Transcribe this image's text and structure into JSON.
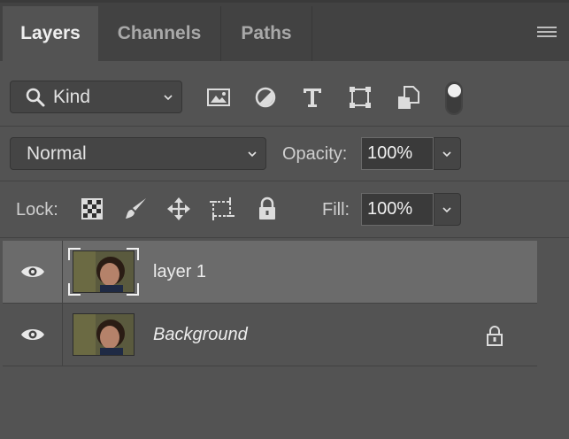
{
  "tabs": [
    {
      "label": "Layers",
      "active": true
    },
    {
      "label": "Channels",
      "active": false
    },
    {
      "label": "Paths",
      "active": false
    }
  ],
  "filter": {
    "kind_label": "Kind",
    "icons": [
      "image-filter-icon",
      "adjustment-filter-icon",
      "type-filter-icon",
      "shape-filter-icon",
      "smart-object-filter-icon"
    ]
  },
  "blend": {
    "mode": "Normal",
    "opacity_label": "Opacity:",
    "opacity_value": "100%"
  },
  "lock": {
    "label": "Lock:",
    "fill_label": "Fill:",
    "fill_value": "100%",
    "icons": [
      "lock-transparent-pixels-icon",
      "lock-image-pixels-icon",
      "lock-position-icon",
      "lock-artboard-icon",
      "lock-all-icon"
    ]
  },
  "layers": [
    {
      "name": "layer 1",
      "selected": true,
      "locked": false
    },
    {
      "name": "Background",
      "selected": false,
      "locked": true
    }
  ],
  "colors": {
    "panel_bg": "#535353",
    "tabbar_bg": "#424242",
    "selected_row": "#6b6b6b"
  }
}
